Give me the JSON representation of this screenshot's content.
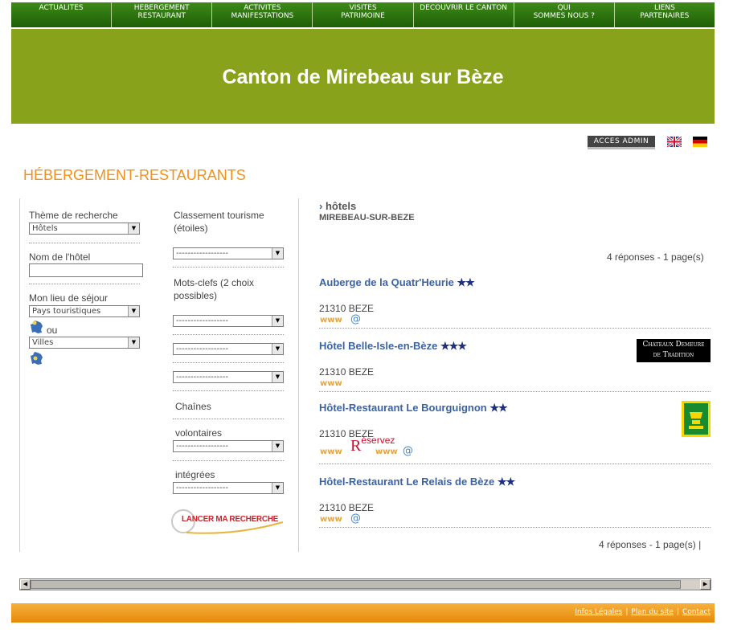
{
  "nav": [
    {
      "label": "ACTUALITES"
    },
    {
      "label": "HEBERGEMENT\nRESTAURANT"
    },
    {
      "label": "ACTIVITES\nMANIFESTATIONS"
    },
    {
      "label": "VISITES\nPATRIMOINE"
    },
    {
      "label": "DECOUVRIR LE CANTON"
    },
    {
      "label": "QUI\nSOMMES NOUS ?"
    },
    {
      "label": "LIENS\nPARTENAIRES"
    }
  ],
  "site_title": "Canton de Mirebeau sur Bèze",
  "admin_label": "ACCES ADMIN",
  "page_title": "HÉBERGEMENT-RESTAURANTS",
  "search": {
    "theme_label": "Thème de recherche",
    "theme_value": "Hôtels",
    "hotel_name_label": "Nom de l'hôtel",
    "stay_label": "Mon lieu de séjour",
    "pays_value": "Pays touristiques",
    "ou_label": "ou",
    "villes_value": "Villes",
    "classement_label": "Classement tourisme (étoiles)",
    "blank_option": "------------------",
    "keywords_label": "Mots-clefs (2 choix possibles)",
    "chains_label": "Chaînes",
    "voluntary_label": "volontaires",
    "integrated_label": "intégrées",
    "submit_label": "LANCER MA RECHERCHE"
  },
  "results": {
    "category": "hôtels",
    "location": "MIREBEAU-SUR-BEZE",
    "count_text": "4 réponses - 1 page(s)",
    "count_text_bottom": "4 réponses - 1 page(s)  |",
    "www_label": "www",
    "at_label": "@",
    "items": [
      {
        "name": "Auberge de la Quatr'Heurie",
        "stars": "★★",
        "zip": "21310 BEZE"
      },
      {
        "name": "Hôtel Belle-Isle-en-Bèze",
        "stars": "★★★",
        "zip": "21310 BEZE",
        "badge_line1": "Chateaux Demeure",
        "badge_line2": "de Tradition"
      },
      {
        "name": "Hôtel-Restaurant Le Bourguignon",
        "stars": "★★",
        "zip": "21310 BEZE",
        "reservez_r": "R",
        "reservez_rest": "éservez"
      },
      {
        "name": "Hôtel-Restaurant Le Relais de Bèze",
        "stars": "★★",
        "zip": "21310 BEZE"
      }
    ]
  },
  "footer": {
    "legal": "Infos Légales",
    "sitemap": "Plan du site",
    "contact": "Contact",
    "sep": "|"
  },
  "colors": {
    "nav_green": "#2e7410",
    "banner_green": "#88a21b",
    "title_orange": "#f0911a",
    "footer_orange": "#ee9a1f",
    "link_blue": "#3a63a6"
  }
}
